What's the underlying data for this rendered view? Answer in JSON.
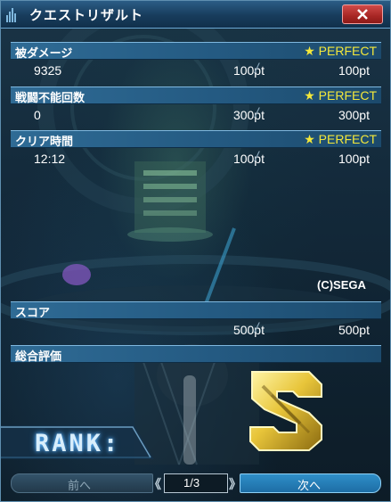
{
  "window": {
    "title": "クエストリザルト"
  },
  "rows": [
    {
      "label": "被ダメージ",
      "badge": "★ PERFECT",
      "value": "9325",
      "points": "100pt",
      "slash": "/",
      "max": "100pt"
    },
    {
      "label": "戦闘不能回数",
      "badge": "★ PERFECT",
      "value": "0",
      "points": "300pt",
      "slash": "/",
      "max": "300pt"
    },
    {
      "label": "クリア時間",
      "badge": "★ PERFECT",
      "value": "12:12",
      "points": "100pt",
      "slash": "/",
      "max": "100pt"
    }
  ],
  "copyright": "(C)SEGA",
  "score": {
    "label": "スコア",
    "points": "500pt",
    "slash": "/",
    "max": "500pt"
  },
  "overall": {
    "label": "総合評価",
    "rank_label": "RANK:",
    "rank_value": "S"
  },
  "nav": {
    "prev_label": "前へ",
    "page": "1/3",
    "next_label": "次へ",
    "prev_chevrons": "《",
    "next_chevrons": "》"
  },
  "colors": {
    "perfect": "#f4e83a",
    "header": "#245a82",
    "close": "#b0302e",
    "next_button": "#2f8fc8"
  },
  "icons": {
    "close": "close-icon",
    "rank": "rank-s-icon"
  }
}
